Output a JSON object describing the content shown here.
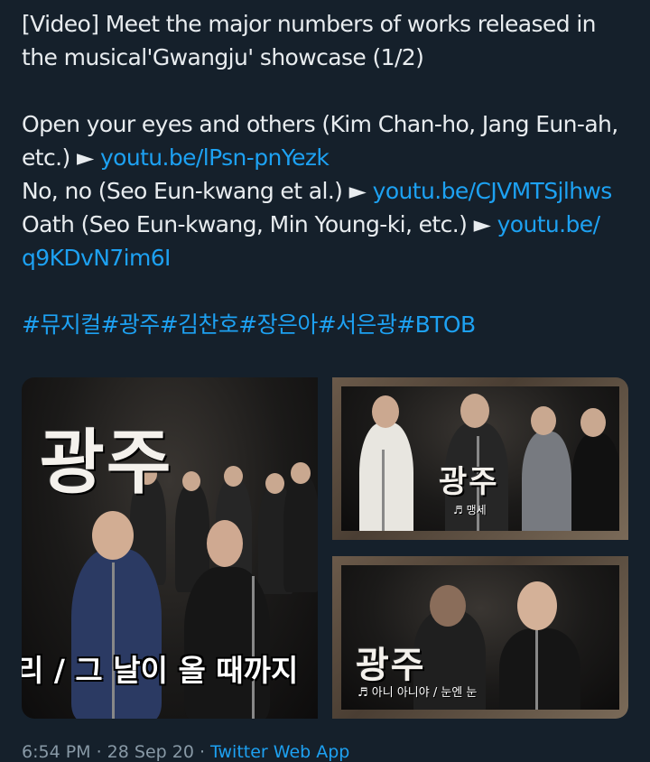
{
  "tweet": {
    "line1": "[Video] Meet the major numbers of works released in",
    "line2": "the musical'Gwangju' showcase (1/2)",
    "item1_text": " Open your eyes and others (Kim Chan-ho, Jang Eun-ah,",
    "item1_text2": "etc.) ► ",
    "item1_link": "youtu.be/lPsn-pnYezk",
    "item2_text": " No, no (Seo Eun-kwang et al.) ► ",
    "item2_link": "youtu.be/CJVMTSjlhws",
    "item3_text": " Oath (Seo Eun-kwang, Min Young-ki, etc.) ► ",
    "item3_link": "youtu.be/",
    "item3_link2": "q9KDvN7im6I",
    "hashtags": "#뮤지컬#광주#김찬호#장은아#서은광#BTOB"
  },
  "media": {
    "left": {
      "logo": "광주",
      "subtitle": "리 / 그 날이 올 때까지"
    },
    "top_right": {
      "logo": "광주",
      "caption": "♬ 맹세"
    },
    "bottom_right": {
      "logo": "광주",
      "caption": "♬ 아니 아니야 / 눈엔 눈"
    }
  },
  "footer": {
    "time": "6:54 PM · 28 Sep 20 · ",
    "app": "Twitter Web App"
  },
  "colors": {
    "background": "#15202b",
    "link": "#1da1f2",
    "muted": "#8899a6"
  }
}
